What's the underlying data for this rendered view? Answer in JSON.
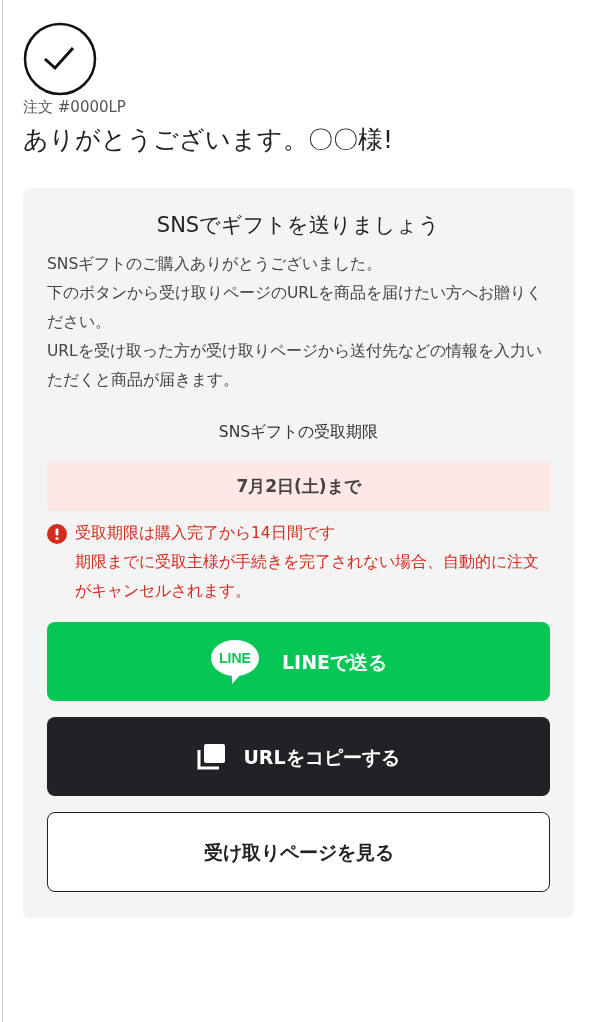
{
  "order_number": "注文 #0000LP",
  "thanks": "ありがとうございます。〇〇様!",
  "gift_card": {
    "title": "SNSでギフトを送りましょう",
    "paragraphs": [
      "SNSギフトのご購入ありがとうございました。",
      "下のボタンから受け取りページのURLを商品を届けたい方へお贈りください。",
      "URLを受け取った方が受け取りページから送付先などの情報を入力いただくと商品が届きます。"
    ],
    "deadline_label": "SNSギフトの受取期限",
    "deadline": "7月2日(土)まで",
    "warnings": [
      "受取期限は購入完了から14日間です",
      "期限までに受取主様が手続きを完了されない場合、自動的に注文がキャンセルされます。"
    ],
    "buttons": [
      {
        "kind": "line",
        "label": "LINEで送る",
        "logo_text": "LINE"
      },
      {
        "kind": "copy",
        "label": "URLをコピーする"
      },
      {
        "kind": "outline",
        "label": "受け取りページを見る"
      }
    ]
  }
}
